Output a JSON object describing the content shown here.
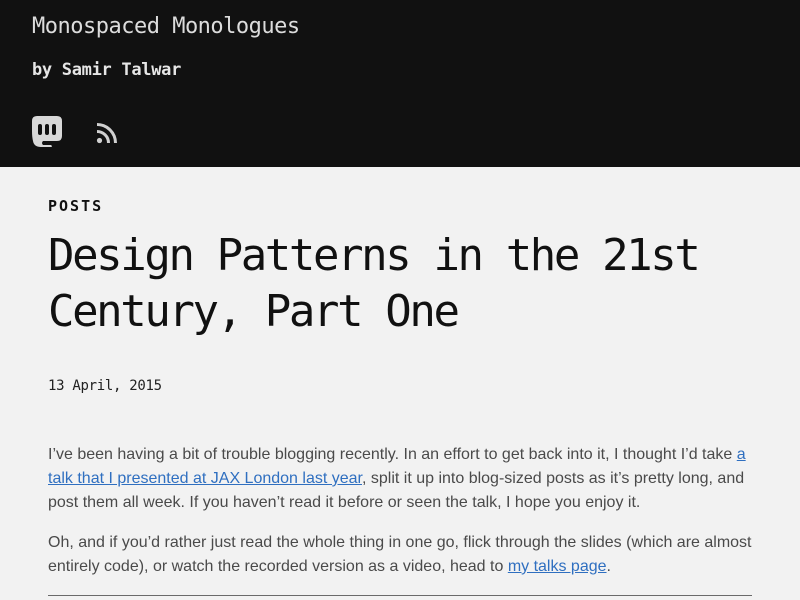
{
  "header": {
    "site_title": "Monospaced Monologues",
    "byline": "by Samir Talwar",
    "icons": [
      "mastodon-icon",
      "rss-icon"
    ],
    "background_color": "#111111"
  },
  "post": {
    "section": "POSTS",
    "title": "Design Patterns in the 21st Century, Part One",
    "date": "13 April, 2015",
    "para1": {
      "t1": "I’ve been having a bit of trouble blogging recently. In an effort to get back into it, I thought I’d take ",
      "link": "a talk that I presented at JAX London last year",
      "t2": ", split it up into blog-sized posts as it’s pretty long, and post them all week. If you haven’t read it before or seen the talk, I hope you enjoy it."
    },
    "para2": {
      "t1": "Oh, and if you’d rather just read the whole thing in one go, flick through the slides (which are almost entirely code), or watch the recorded version as a video, head to ",
      "link": "my talks page",
      "t2": "."
    }
  },
  "colors": {
    "page_background": "#f2f2f2",
    "link": "#2f6fc0",
    "text": "#4a4a4a"
  }
}
